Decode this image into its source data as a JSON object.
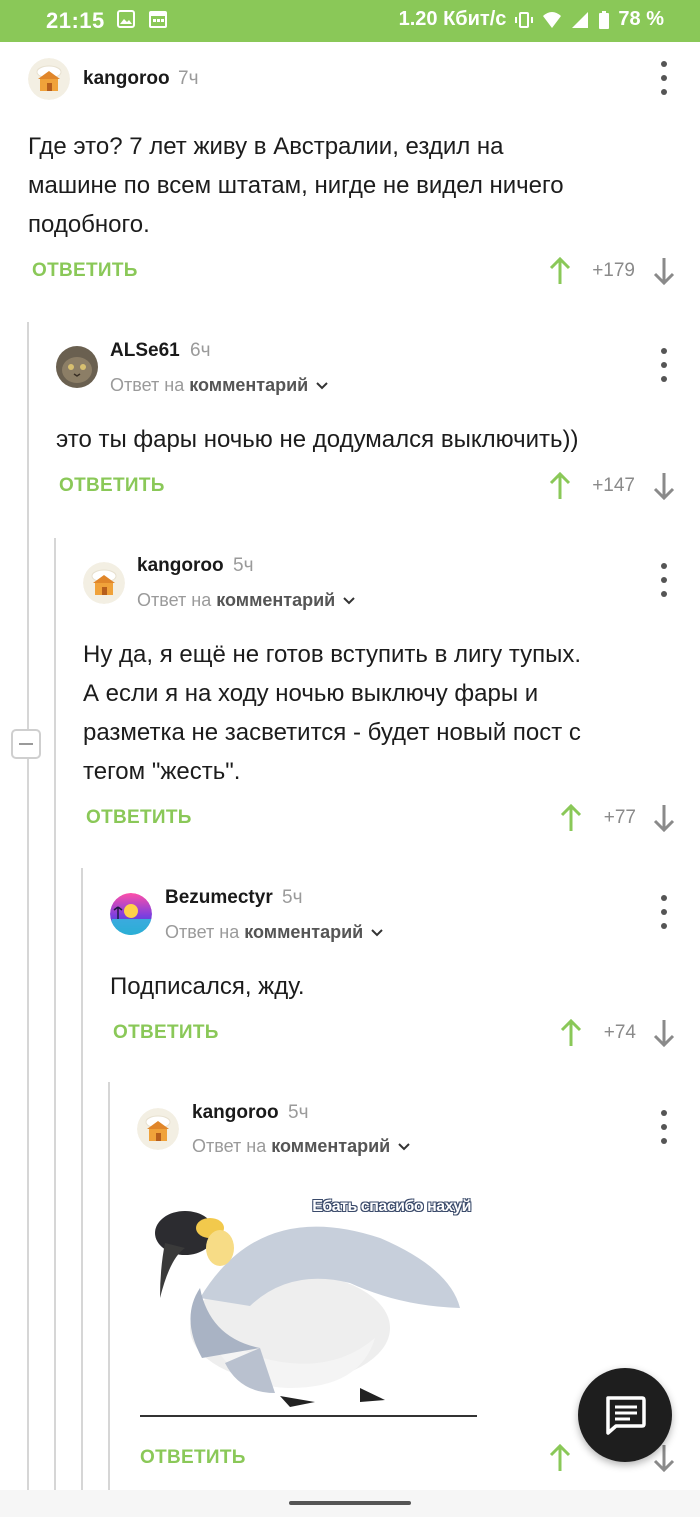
{
  "status_bar": {
    "time": "21:15",
    "network_speed": "1.20 Кбит/с",
    "battery": "78 %",
    "icons": [
      "gallery-icon",
      "calendar-icon",
      "vibrate-icon",
      "wifi-icon",
      "signal-icon",
      "battery-icon"
    ]
  },
  "colors": {
    "accent": "#8ac858",
    "text": "#1c1c1c",
    "muted": "#9a9a9a",
    "fab": "#1e1e1e"
  },
  "comments": [
    {
      "user": "kangoroo",
      "time": "7ч",
      "text_lines": [
        "Где это? 7 лет живу в Австралии, ездил на",
        "машине по всем штатам, нигде не видел ничего",
        "подобного."
      ],
      "reply_label": "ОТВЕТИТЬ",
      "score": "+179"
    },
    {
      "user": "ALSe61",
      "time": "6ч",
      "reply_prefix": "Ответ на",
      "reply_target": "комментарий",
      "text_lines": [
        "это ты фары ночью не додумался выключить))"
      ],
      "reply_label": "ОТВЕТИТЬ",
      "score": "+147"
    },
    {
      "user": "kangoroo",
      "time": "5ч",
      "reply_prefix": "Ответ на",
      "reply_target": "комментарий",
      "text_lines": [
        "Ну да, я ещё не готов вступить в лигу тупых.",
        "А если я на ходу ночью выключу фары и",
        "разметка не засветится - будет новый пост с",
        "тегом \"жесть\"."
      ],
      "reply_label": "ОТВЕТИТЬ",
      "score": "+77"
    },
    {
      "user": "Bezumectyr",
      "time": "5ч",
      "reply_prefix": "Ответ на",
      "reply_target": "комментарий",
      "text_lines": [
        "Подписался, жду."
      ],
      "reply_label": "ОТВЕТИТЬ",
      "score": "+74"
    },
    {
      "user": "kangoroo",
      "time": "5ч",
      "reply_prefix": "Ответ на",
      "reply_target": "комментарий",
      "image_caption": "Ебать спасибо нахуй",
      "reply_label": "ОТВЕТИТЬ"
    }
  ]
}
